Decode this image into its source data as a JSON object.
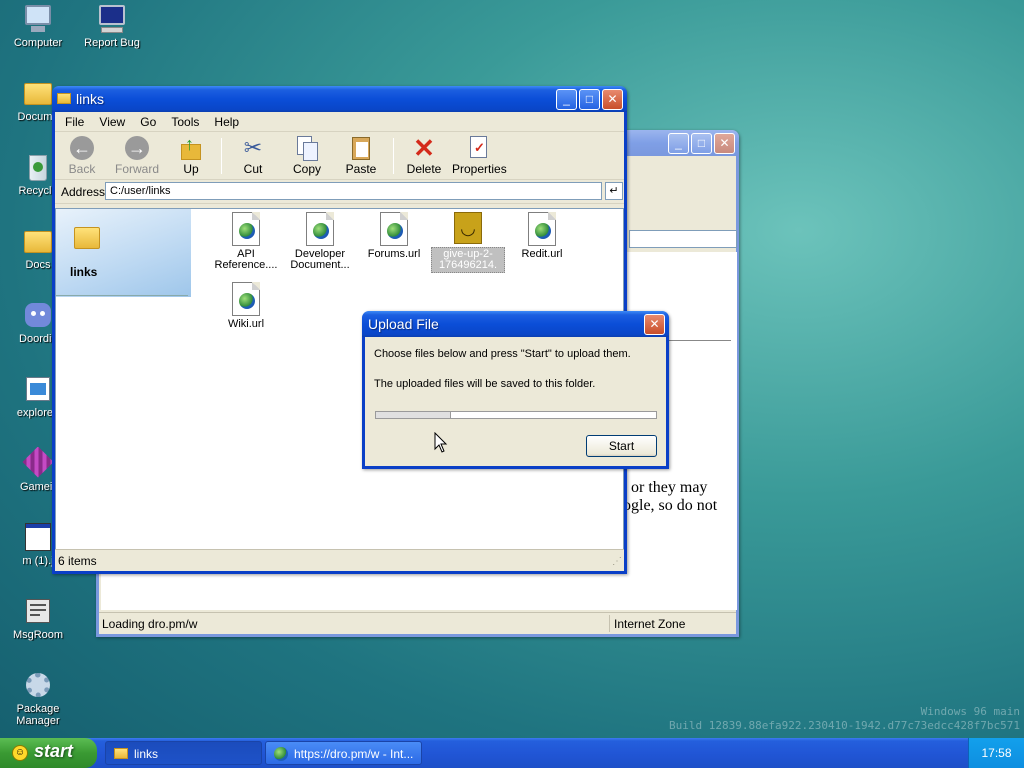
{
  "desktop": {
    "icons": [
      {
        "label": "Computer"
      },
      {
        "label": "Report Bug"
      },
      {
        "label": "Docume"
      },
      {
        "label": "Recycle"
      },
      {
        "label": "Docs"
      },
      {
        "label": "Doordis"
      },
      {
        "label": "explorer."
      },
      {
        "label": "Gameir"
      },
      {
        "label": "m (1).j"
      },
      {
        "label": "MsgRoom"
      },
      {
        "label": "Package Manager"
      }
    ],
    "watermark_line1": "Windows 96 main",
    "watermark_line2": "Build 12839.88efa922.230410-1942.d77c73edcc428f7bc571"
  },
  "browser_window": {
    "page_text_line1": ", or they may",
    "page_text_line2": "ogle, so do not",
    "status_text": "Loading dro.pm/w",
    "zone_text": "Internet Zone"
  },
  "explorer": {
    "title": "links",
    "menu": [
      "File",
      "View",
      "Go",
      "Tools",
      "Help"
    ],
    "toolbar": {
      "back": "Back",
      "forward": "Forward",
      "up": "Up",
      "cut": "Cut",
      "copy": "Copy",
      "paste": "Paste",
      "delete": "Delete",
      "properties": "Properties"
    },
    "address_label": "Address",
    "address_value": "C:/user/links",
    "side_title": "links",
    "files": [
      {
        "line1": "API",
        "line2": "Reference...."
      },
      {
        "line1": "Developer",
        "line2": "Document..."
      },
      {
        "line1": "Forums.url",
        "line2": ""
      },
      {
        "line1": "give-up-2-",
        "line2": "176496214."
      },
      {
        "line1": "Redit.url",
        "line2": ""
      },
      {
        "line1": "Wiki.url",
        "line2": ""
      }
    ],
    "status": "6 items"
  },
  "upload_dialog": {
    "title": "Upload File",
    "line1": "Choose files below and press \"Start\" to upload them.",
    "line2": "The uploaded files will be saved to this folder.",
    "start_label": "Start"
  },
  "taskbar": {
    "start_label": "start",
    "tasks": [
      "links",
      "https://dro.pm/w - Int..."
    ],
    "clock": "17:58"
  }
}
